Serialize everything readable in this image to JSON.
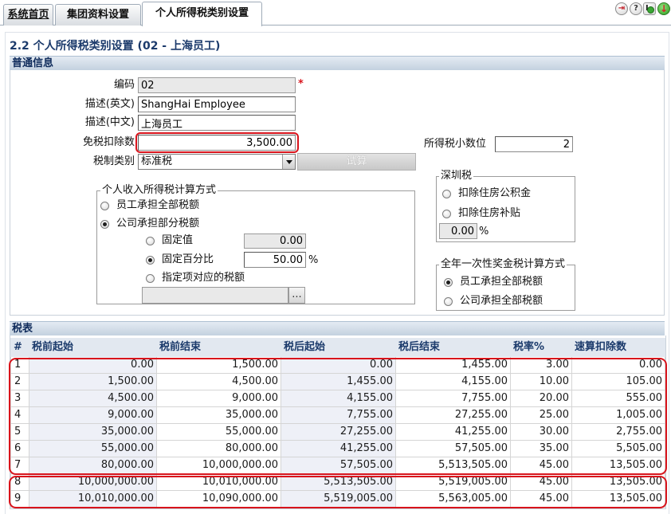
{
  "tabs": [
    {
      "label": "系统首页"
    },
    {
      "label": "集团资料设置"
    },
    {
      "label": "个人所得税类别设置"
    }
  ],
  "toolbar_icons": [
    "switch-icon",
    "help-icon",
    "logout-icon",
    "exit-icon"
  ],
  "page_title": "2.2 个人所得税类别设置 (02 - 上海员工)",
  "general": {
    "section_title": "普通信息",
    "code_label": "编码",
    "code_value": "02",
    "required_mark": "*",
    "desc_en_label": "描述(英文)",
    "desc_en_value": "ShangHai Employee",
    "desc_cn_label": "描述(中文)",
    "desc_cn_value": "上海员工",
    "exemption_label": "免税扣除数",
    "exemption_value": "3,500.00",
    "decimals_label": "所得税小数位",
    "decimals_value": "2",
    "tax_type_label": "税制类别",
    "tax_type_value": "标准税",
    "trial_button": "试算"
  },
  "calc_method": {
    "legend": "个人收入所得税计算方式",
    "employee_all": {
      "label": "员工承担全部税额",
      "checked": false
    },
    "company_part": {
      "label": "公司承担部分税额",
      "checked": true
    },
    "fixed_value": {
      "label": "固定值",
      "checked": false,
      "value": "0.00"
    },
    "fixed_percent": {
      "label": "固定百分比",
      "checked": true,
      "value": "50.00",
      "unit": "%"
    },
    "item_tax": {
      "label": "指定项对应的税额",
      "checked": false,
      "value": ""
    },
    "browse_button": "..."
  },
  "shenzhen_tax": {
    "legend": "深圳税",
    "housing_fund": {
      "label": "扣除住房公积金",
      "checked": false
    },
    "housing_subsidy": {
      "label": "扣除住房补贴",
      "checked": false
    },
    "percent_value": "0.00",
    "unit": "%"
  },
  "bonus_tax": {
    "legend": "全年一次性奖金税计算方式",
    "employee_all": {
      "label": "员工承担全部税额",
      "checked": true
    },
    "company_all": {
      "label": "公司承担全部税额",
      "checked": false
    }
  },
  "tax_table": {
    "section_title": "税表",
    "columns": [
      "#",
      "税前起始",
      "税前结束",
      "税后起始",
      "税后结束",
      "税率%",
      "速算扣除数"
    ],
    "rows": [
      [
        "1",
        "0.00",
        "1,500.00",
        "0.00",
        "1,455.00",
        "3.00",
        "0.00"
      ],
      [
        "2",
        "1,500.00",
        "4,500.00",
        "1,455.00",
        "4,155.00",
        "10.00",
        "105.00"
      ],
      [
        "3",
        "4,500.00",
        "9,000.00",
        "4,155.00",
        "7,755.00",
        "20.00",
        "555.00"
      ],
      [
        "4",
        "9,000.00",
        "35,000.00",
        "7,755.00",
        "27,255.00",
        "25.00",
        "1,005.00"
      ],
      [
        "5",
        "35,000.00",
        "55,000.00",
        "27,255.00",
        "41,255.00",
        "30.00",
        "2,755.00"
      ],
      [
        "6",
        "55,000.00",
        "80,000.00",
        "41,255.00",
        "57,505.00",
        "35.00",
        "5,505.00"
      ],
      [
        "7",
        "80,000.00",
        "10,000,000.00",
        "57,505.00",
        "5,513,505.00",
        "45.00",
        "13,505.00"
      ],
      [
        "8",
        "10,000,000.00",
        "10,010,000.00",
        "5,513,505.00",
        "5,519,005.00",
        "45.00",
        "13,505.00"
      ],
      [
        "9",
        "10,010,000.00",
        "10,090,000.00",
        "5,519,005.00",
        "5,563,005.00",
        "45.00",
        "13,505.00"
      ]
    ]
  },
  "colors": {
    "title_text": "#1b3a6b",
    "section_bar": "#c8d5e2",
    "highlight": "#d8141c",
    "required": "#d8141c"
  }
}
